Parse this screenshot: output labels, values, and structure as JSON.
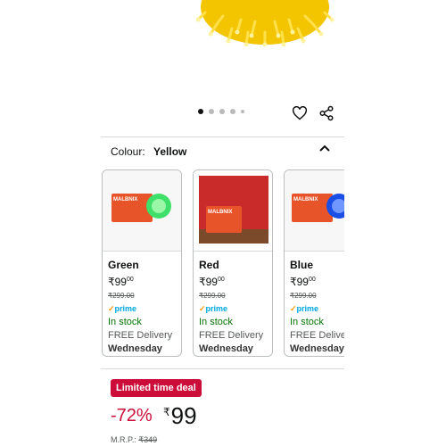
{
  "gallery": {
    "dot_count": 5,
    "active_index": 0
  },
  "colour": {
    "label": "Colour:",
    "selected": "Yellow"
  },
  "variants": [
    {
      "name": "Green",
      "price_whole": "₹99",
      "price_fraction": "00",
      "mrp": "₹299.00",
      "prime": "prime",
      "stock": "In stock",
      "delivery": "FREE Delivery",
      "day": "Wednesday",
      "box_label": "MALBNIX",
      "light_color": "#3fe06a"
    },
    {
      "name": "Red",
      "price_whole": "₹99",
      "price_fraction": "00",
      "mrp": "₹299.00",
      "prime": "prime",
      "stock": "In stock",
      "delivery": "FREE Delivery",
      "day": "Wednesday",
      "box_label": "MALBNIX",
      "light_color": "#c92a2a"
    },
    {
      "name": "Blue",
      "price_whole": "₹99",
      "price_fraction": "00",
      "mrp": "₹299.00",
      "prime": "prime",
      "stock": "In stock",
      "delivery": "FREE Delivery",
      "day": "Wednesday",
      "box_label": "MALBNIX",
      "light_color": "#1a4ee6"
    }
  ],
  "deal": {
    "badge": "Limited time deal",
    "discount": "-72%",
    "currency": "₹",
    "price": "99",
    "mrp_label": "M.R.P.:",
    "mrp_value": "₹349"
  },
  "colors": {
    "deal_red": "#cc0c39",
    "stock_green": "#007600",
    "prime_blue": "#00a8e1",
    "hero_yellow": "#f5d10f"
  }
}
